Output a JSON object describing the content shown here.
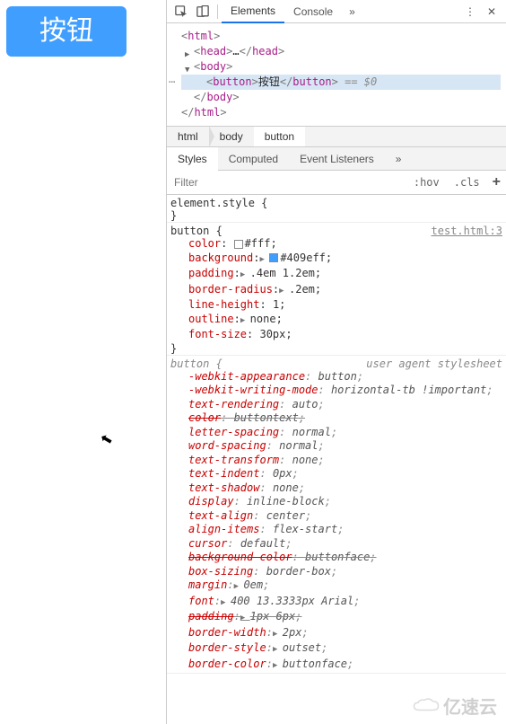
{
  "page": {
    "button_label": "按钮"
  },
  "toolbar": {
    "tabs": {
      "elements": "Elements",
      "console": "Console"
    }
  },
  "tree": {
    "html_open": "html",
    "head": "head",
    "ellipsis": "…",
    "body": "body",
    "button": "button",
    "button_text": "按钮",
    "eq0": " == $0"
  },
  "crumbs": {
    "html": "html",
    "body": "body",
    "button": "button"
  },
  "subtabs": {
    "styles": "Styles",
    "computed": "Computed",
    "listeners": "Event Listeners"
  },
  "filter": {
    "placeholder": "Filter",
    "hov": ":hov",
    "cls": ".cls"
  },
  "rules": {
    "element_style": {
      "selector": "element.style {",
      "close": "}"
    },
    "r1": {
      "selector": "button {",
      "source": "test.html:3",
      "decls": [
        {
          "p": "color",
          "v": "#fff",
          "swatch": "#ffffff"
        },
        {
          "p": "background",
          "v": "#409eff",
          "tri": true,
          "swatch": "#409eff"
        },
        {
          "p": "padding",
          "v": ".4em 1.2em",
          "tri": true
        },
        {
          "p": "border-radius",
          "v": ".2em",
          "tri": true
        },
        {
          "p": "line-height",
          "v": "1"
        },
        {
          "p": "outline",
          "v": "none",
          "tri": true
        },
        {
          "p": "font-size",
          "v": "30px"
        }
      ],
      "close": "}"
    },
    "r2": {
      "selector": "button {",
      "source": "user agent stylesheet",
      "decls": [
        {
          "p": "-webkit-appearance",
          "v": "button"
        },
        {
          "p": "-webkit-writing-mode",
          "v": "horizontal-tb !important"
        },
        {
          "p": "text-rendering",
          "v": "auto"
        },
        {
          "p": "color",
          "v": "buttontext",
          "strike": true
        },
        {
          "p": "letter-spacing",
          "v": "normal"
        },
        {
          "p": "word-spacing",
          "v": "normal"
        },
        {
          "p": "text-transform",
          "v": "none"
        },
        {
          "p": "text-indent",
          "v": "0px"
        },
        {
          "p": "text-shadow",
          "v": "none"
        },
        {
          "p": "display",
          "v": "inline-block"
        },
        {
          "p": "text-align",
          "v": "center"
        },
        {
          "p": "align-items",
          "v": "flex-start"
        },
        {
          "p": "cursor",
          "v": "default"
        },
        {
          "p": "background-color",
          "v": "buttonface",
          "strike": true
        },
        {
          "p": "box-sizing",
          "v": "border-box"
        },
        {
          "p": "margin",
          "v": "0em",
          "tri": true
        },
        {
          "p": "font",
          "v": "400 13.3333px Arial",
          "tri": true
        },
        {
          "p": "padding",
          "v": "1px 6px",
          "tri": true,
          "strike": true
        },
        {
          "p": "border-width",
          "v": "2px",
          "tri": true
        },
        {
          "p": "border-style",
          "v": "outset",
          "tri": true
        },
        {
          "p": "border-color",
          "v": "buttonface",
          "tri": true
        }
      ]
    }
  },
  "watermark": "亿速云"
}
